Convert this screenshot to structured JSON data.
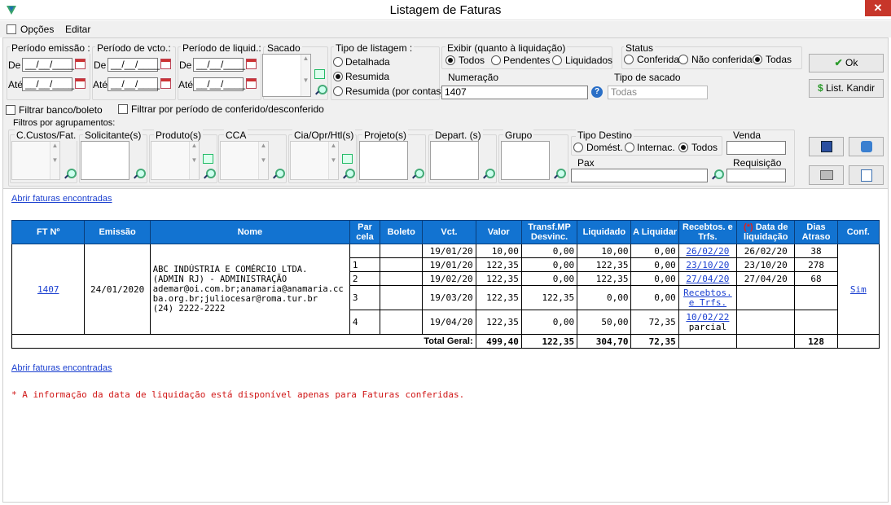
{
  "window": {
    "title": "Listagem de Faturas",
    "close_icon": "close-icon"
  },
  "menu": {
    "opcoes": "Opções",
    "editar": "Editar"
  },
  "filters": {
    "periodo_emissao": "Período emissão :",
    "periodo_vcto": "Período de vcto.:",
    "periodo_liquid": "Período de liquid.:",
    "sacado": "Sacado",
    "de": "De",
    "ate": "Até",
    "date_placeholder": "__/__/____",
    "tipo_listagem": {
      "label": "Tipo de listagem :",
      "options": [
        "Detalhada",
        "Resumida",
        "Resumida (por contas)"
      ],
      "selected": "Resumida"
    },
    "exibir": {
      "label": "Exibir (quanto à liquidação)",
      "options": [
        "Todos",
        "Pendentes",
        "Liquidados"
      ],
      "selected": "Todos"
    },
    "status": {
      "label": "Status",
      "options": [
        "Conferida",
        "Não conferida",
        "Todas"
      ],
      "selected": "Todas"
    },
    "numeracao": {
      "label": "Numeração",
      "value": "1407"
    },
    "tipo_sacado": {
      "label": "Tipo de sacado",
      "value": "Todas"
    },
    "filtrar_banco": "Filtrar banco/boleto",
    "filtrar_periodo": "Filtrar por período de conferido/desconferido",
    "agrupamentos": "Filtros por agrupamentos:",
    "groups": [
      "C.Custos/Fat.",
      "Solicitante(s)",
      "Produto(s)",
      "CCA",
      "Cia/Opr/Htl(s)",
      "Projeto(s)",
      "Depart. (s)",
      "Grupo"
    ],
    "tipo_destino": {
      "label": "Tipo Destino",
      "options": [
        "Domést.",
        "Internac.",
        "Todos"
      ],
      "selected": "Todos"
    },
    "venda": "Venda",
    "pax": "Pax",
    "requisicao": "Requisição"
  },
  "buttons": {
    "ok": "Ok",
    "list_kandir": "List. Kandir"
  },
  "links": {
    "abrir_top": "Abrir faturas encontradas",
    "abrir_bottom": "Abrir faturas encontradas"
  },
  "table": {
    "headers": [
      "FT Nº",
      "Emissão",
      "Nome",
      "Par cela",
      "Boleto",
      "Vct.",
      "Valor",
      "Transf.MP Desvinc.",
      "Liquidado",
      "A Liquidar",
      "Recebtos. e Trfs.",
      "(*) Data de liquidação",
      "Dias Atraso",
      "Conf."
    ],
    "ft": "1407",
    "emissao": "24/01/2020",
    "nome": [
      "ABC INDÚSTRIA E COMÉRCIO LTDA.",
      "(ADMIN RJ) - ADMINISTRAÇÃO",
      "ademar@oi.com.br;anamaria@anamaria.cc",
      "ba.org.br;juliocesar@roma.tur.br",
      "(24) 2222-2222"
    ],
    "conf": "Sim",
    "rows": [
      {
        "parcela": "",
        "vct": "19/01/20",
        "valor": "10,00",
        "transf": "0,00",
        "liquidado": "10,00",
        "aliquidar": "0,00",
        "receb": "26/02/20",
        "receb2": "",
        "data_liq": "26/02/20",
        "dias": "38"
      },
      {
        "parcela": "1",
        "vct": "19/01/20",
        "valor": "122,35",
        "transf": "0,00",
        "liquidado": "122,35",
        "aliquidar": "0,00",
        "receb": "23/10/20",
        "receb2": "",
        "data_liq": "23/10/20",
        "dias": "278"
      },
      {
        "parcela": "2",
        "vct": "19/02/20",
        "valor": "122,35",
        "transf": "0,00",
        "liquidado": "122,35",
        "aliquidar": "0,00",
        "receb": "27/04/20",
        "receb2": "",
        "data_liq": "27/04/20",
        "dias": "68"
      },
      {
        "parcela": "3",
        "vct": "19/03/20",
        "valor": "122,35",
        "transf": "122,35",
        "liquidado": "0,00",
        "aliquidar": "0,00",
        "receb": "Recebtos.",
        "receb2": "e Trfs.",
        "data_liq": "",
        "dias": ""
      },
      {
        "parcela": "4",
        "vct": "19/04/20",
        "valor": "122,35",
        "transf": "0,00",
        "liquidado": "50,00",
        "aliquidar": "72,35",
        "receb": "10/02/22",
        "receb2": "parcial",
        "data_liq": "",
        "dias": ""
      }
    ],
    "total": {
      "label": "Total Geral:",
      "valor": "499,40",
      "transf": "122,35",
      "liquidado": "304,70",
      "aliquidar": "72,35",
      "dias": "128"
    }
  },
  "note": "* A informação da data de liquidação está disponível apenas para Faturas conferidas."
}
